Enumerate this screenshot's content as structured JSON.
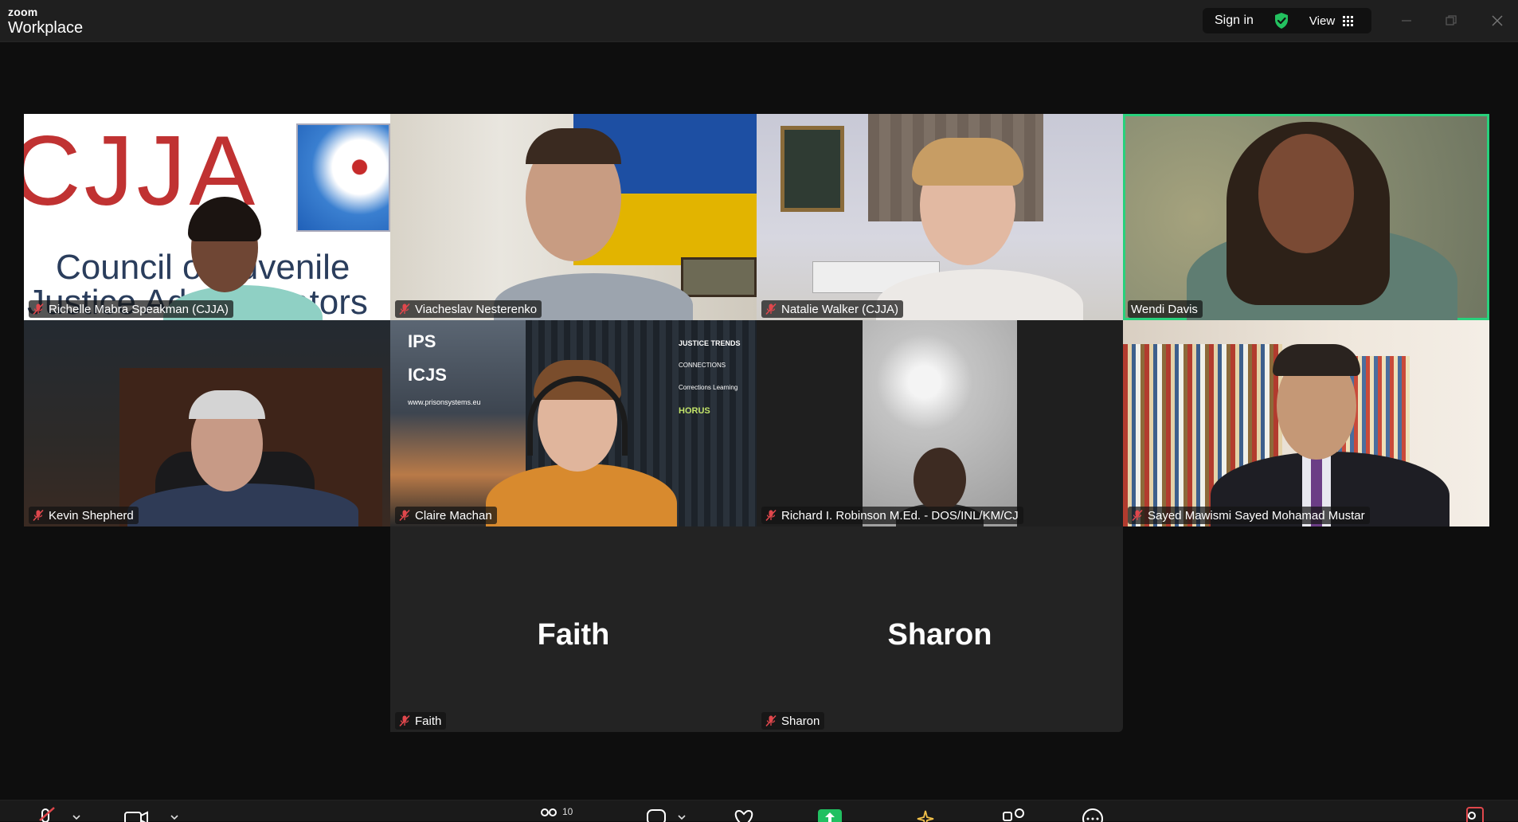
{
  "app": {
    "brand_small": "zoom",
    "brand_large": "Workplace"
  },
  "titlebar": {
    "sign_in_label": "Sign in",
    "view_label": "View"
  },
  "accent_color": "#28d17c",
  "participants": [
    {
      "name": "Richelle Mabra Speakman (CJJA)",
      "muted": true,
      "video": true,
      "background_text": {
        "logo": "CJJA",
        "line1": "Council of Juvenile",
        "line2": "Justice Administrators"
      }
    },
    {
      "name": "Viacheslav Nesterenko",
      "muted": true,
      "video": true
    },
    {
      "name": "Natalie Walker (CJJA)",
      "muted": true,
      "video": true
    },
    {
      "name": "Wendi Davis",
      "muted": false,
      "video": true,
      "active_speaker": true
    },
    {
      "name": "Kevin Shepherd",
      "muted": true,
      "video": true
    },
    {
      "name": "Claire Machan",
      "muted": true,
      "video": true,
      "background_text": {
        "brand1": "IPS",
        "brand2": "ICJS",
        "url": "www.prisonsystems.eu",
        "right1": "JUSTICE TRENDS",
        "right2": "CONNECTIONS",
        "right3": "Corrections Learning",
        "right4": "HORUS"
      }
    },
    {
      "name": "Richard I.  Robinson M.Ed. - DOS/INL/KM/CJ",
      "muted": true,
      "video": true
    },
    {
      "name": "Sayed Mawismi Sayed Mohamad Mustar",
      "muted": true,
      "video": true
    },
    {
      "name": "Faith",
      "muted": true,
      "video": false,
      "display_name": "Faith"
    },
    {
      "name": "Sharon",
      "muted": true,
      "video": false,
      "display_name": "Sharon"
    }
  ],
  "toolbar": {
    "participants_count": "10"
  }
}
